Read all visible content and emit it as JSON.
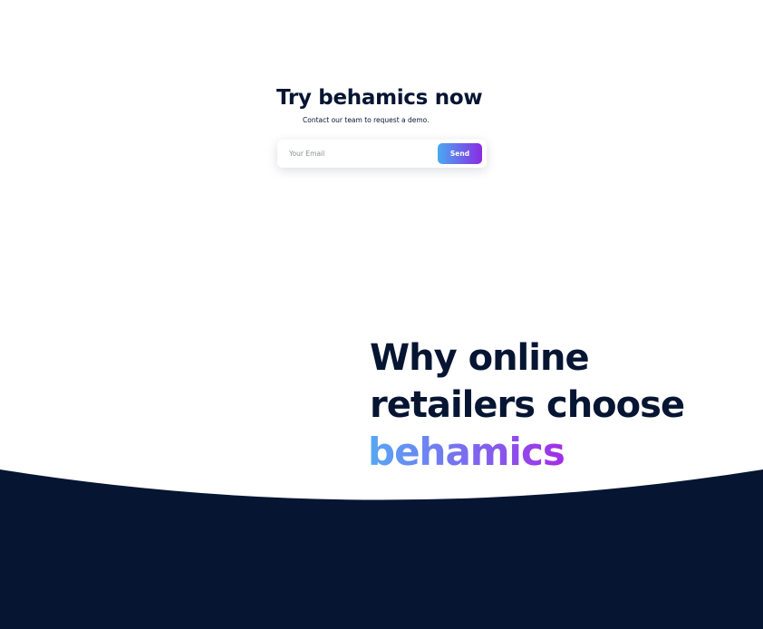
{
  "demo": {
    "title": "Try behamics now",
    "subtitle": "Contact our team to request a demo.",
    "email_placeholder": "Your Email",
    "send_label": "Send"
  },
  "why": {
    "line1": "Why online",
    "line2": "retailers choose",
    "brand": "behamics"
  },
  "colors": {
    "navy": "#061532",
    "gradient_start": "#4aa9f2",
    "gradient_end": "#8a2be2"
  }
}
